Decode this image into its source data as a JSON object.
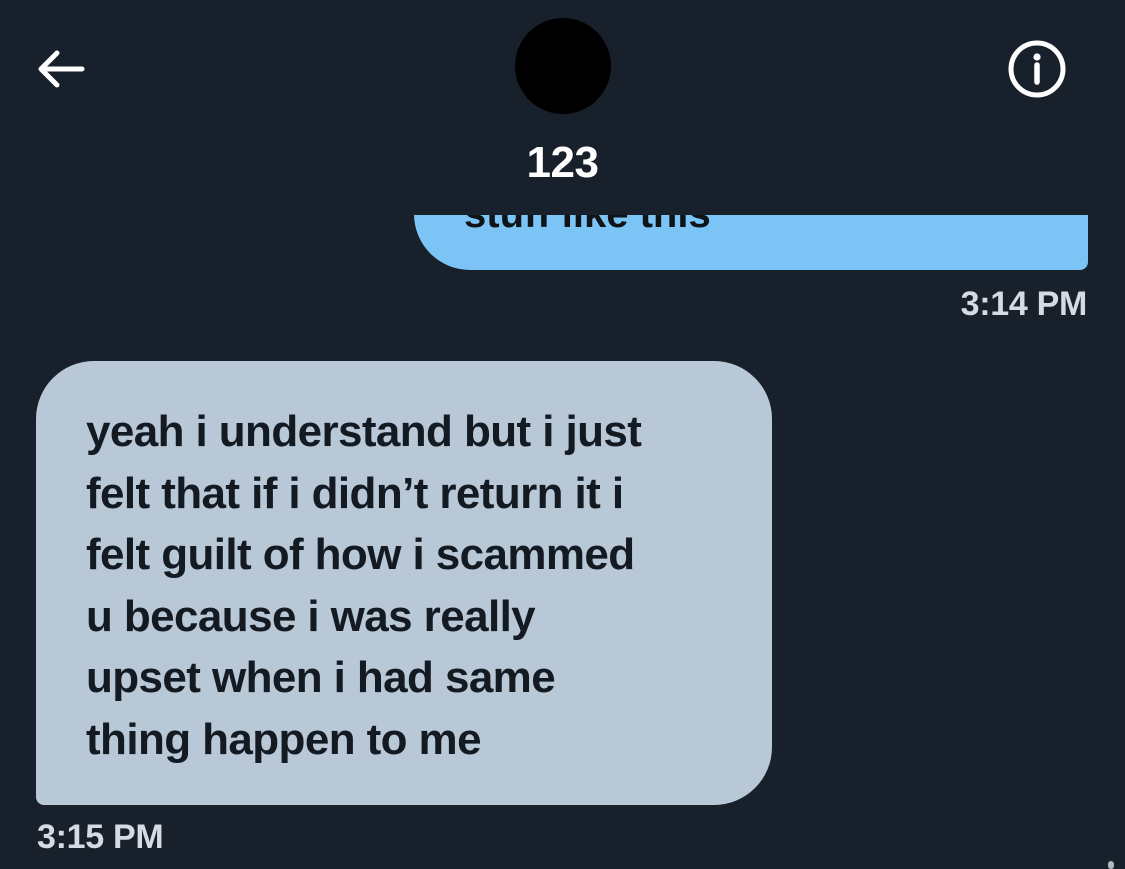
{
  "header": {
    "contact_name": "123",
    "back_icon": "arrow-left-icon",
    "info_icon": "info-circle-icon"
  },
  "messages": {
    "sent": {
      "text": "stuff like this",
      "time": "3:14 PM",
      "bubble_color": "#7cc4f5"
    },
    "received": {
      "lines": [
        "yeah i understand but i just",
        "felt that if i didn’t return it i",
        "felt guilt of how i scammed",
        "u because i was really",
        "upset when i had same",
        "thing happen to me"
      ],
      "time": "3:15 PM",
      "bubble_color": "#b8c8d6"
    }
  },
  "theme": {
    "background": "#18202b",
    "primary_text": "#ffffff",
    "timestamp_text": "#d4dbe2"
  }
}
